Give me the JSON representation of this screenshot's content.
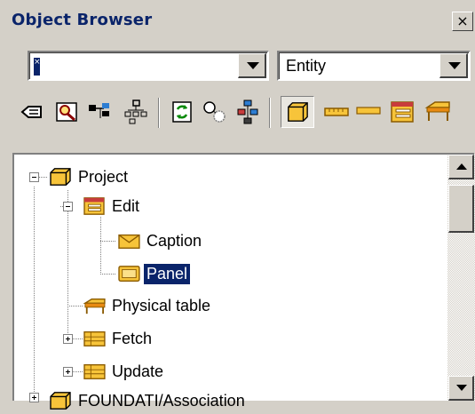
{
  "window": {
    "title": "Object Browser",
    "close_glyph": "×"
  },
  "filters": {
    "name_value": "",
    "caret_marker": "×",
    "type_value": "Entity"
  },
  "toolbar": {
    "icons": [
      "back-icon",
      "find-icon",
      "flag-icon",
      "hierarchy-icon",
      "refresh-icon",
      "circles-icon",
      "network-icon",
      "entity-icon",
      "ruler-icon",
      "form-icon",
      "table-icon"
    ]
  },
  "tree": {
    "items": [
      {
        "label": "Project",
        "icon": "entity-icon"
      },
      {
        "label": "Edit",
        "icon": "form-icon"
      },
      {
        "label": "Caption",
        "icon": "caption-icon"
      },
      {
        "label": "Panel",
        "icon": "panel-icon",
        "selected": true
      },
      {
        "label": "Physical table",
        "icon": "physical-table-icon"
      },
      {
        "label": "Fetch",
        "icon": "list-icon"
      },
      {
        "label": "Update",
        "icon": "list-icon"
      },
      {
        "label": "FOUNDATI/Association",
        "icon": "entity-icon"
      }
    ]
  },
  "colors": {
    "title_text": "#0a246a",
    "selection": "#0a246a",
    "chrome": "#d4d0c8",
    "icon_yellow": "#f7c43a",
    "icon_orange": "#e88a12"
  }
}
